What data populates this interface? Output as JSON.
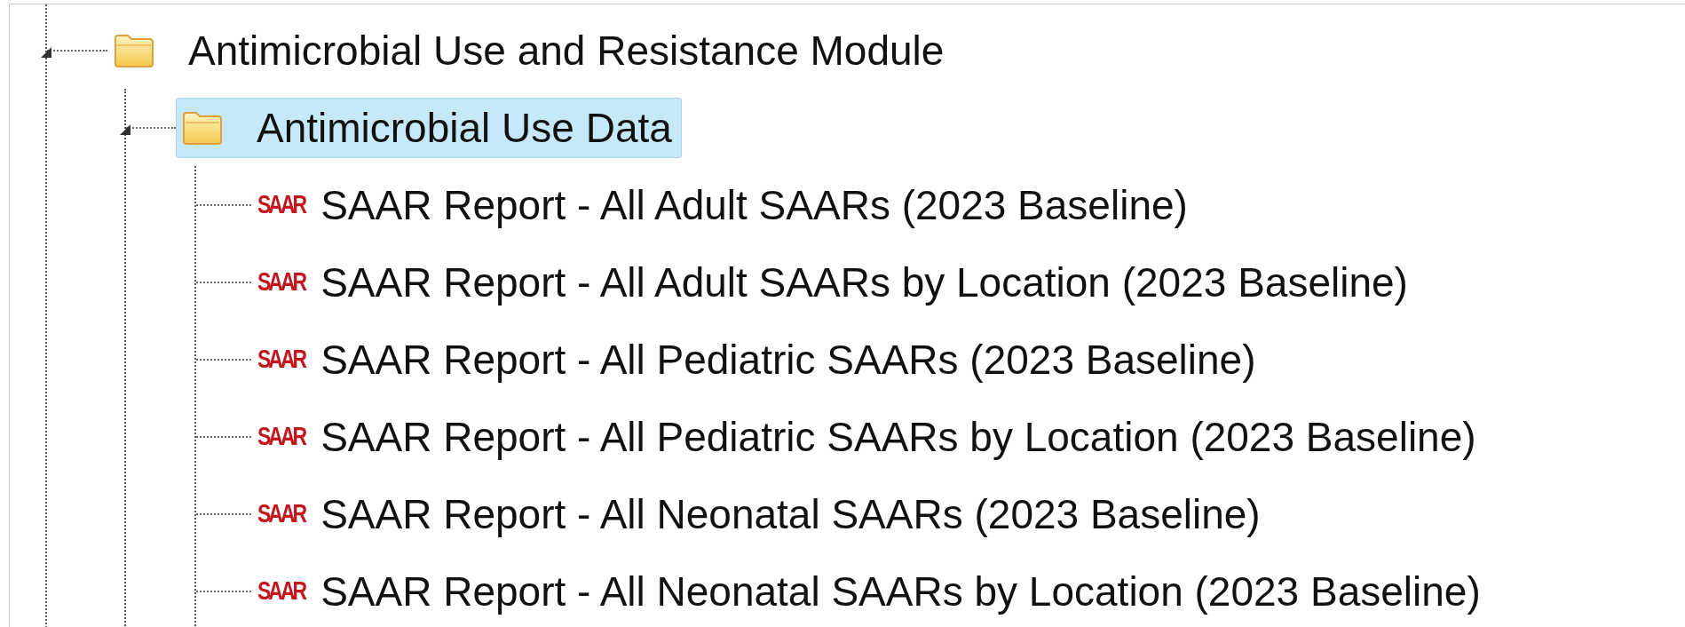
{
  "tree": [
    {
      "label": "Antimicrobial Use and Resistance Module",
      "kind": "folder",
      "expanded": true,
      "selected": false,
      "children": [
        {
          "label": "Antimicrobial Use Data",
          "kind": "folder",
          "expanded": true,
          "selected": true,
          "children": [
            {
              "label": "SAAR Report - All Adult SAARs (2023 Baseline)",
              "kind": "report",
              "badge": "SAAR",
              "selected": false
            },
            {
              "label": "SAAR Report - All Adult SAARs by Location (2023 Baseline)",
              "kind": "report",
              "badge": "SAAR",
              "selected": false
            },
            {
              "label": "SAAR Report - All Pediatric SAARs (2023 Baseline)",
              "kind": "report",
              "badge": "SAAR",
              "selected": false
            },
            {
              "label": "SAAR Report - All Pediatric SAARs by Location (2023 Baseline)",
              "kind": "report",
              "badge": "SAAR",
              "selected": false
            },
            {
              "label": "SAAR Report - All Neonatal SAARs (2023 Baseline)",
              "kind": "report",
              "badge": "SAAR",
              "selected": false
            },
            {
              "label": "SAAR Report - All Neonatal SAARs by Location (2023 Baseline)",
              "kind": "report",
              "badge": "SAAR",
              "selected": false
            }
          ]
        }
      ]
    }
  ]
}
